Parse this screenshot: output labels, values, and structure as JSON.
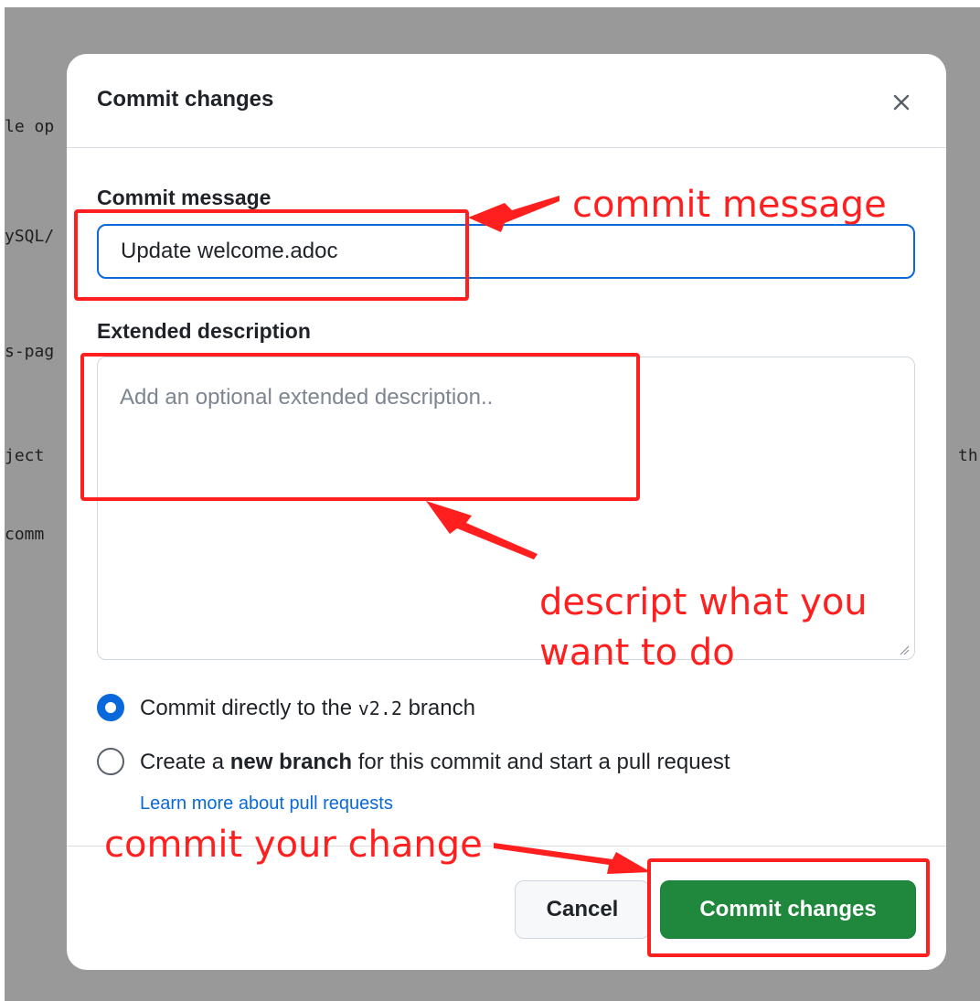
{
  "background_code": {
    "line1": "le op",
    "line2": "ySQL/",
    "line3": "s-pag",
    "line4": "ject",
    "line5": " comm",
    "line6": "th"
  },
  "dialog": {
    "title": "Commit changes",
    "close_glyph": "✕"
  },
  "commit_message": {
    "label": "Commit message",
    "value": "Update welcome.adoc"
  },
  "extended_description": {
    "label": "Extended description",
    "placeholder": "Add an optional extended description.."
  },
  "options": {
    "direct": {
      "prefix": "Commit directly to the ",
      "branch": "v2.2",
      "suffix": " branch",
      "selected": true
    },
    "new_branch": {
      "prefix": "Create a ",
      "bold": "new branch",
      "suffix": " for this commit and start a pull request",
      "selected": false
    },
    "learn_more": "Learn more about pull requests"
  },
  "buttons": {
    "cancel": "Cancel",
    "commit": "Commit changes"
  },
  "annotations": {
    "commit_message": "commit message",
    "describe_line1": "descript what you",
    "describe_line2": "want to do",
    "commit_change": "commit your change",
    "color": "#ff1f1f"
  },
  "colors": {
    "primary_blue": "#0969da",
    "commit_green": "#1f883d",
    "backdrop": "#999999"
  }
}
